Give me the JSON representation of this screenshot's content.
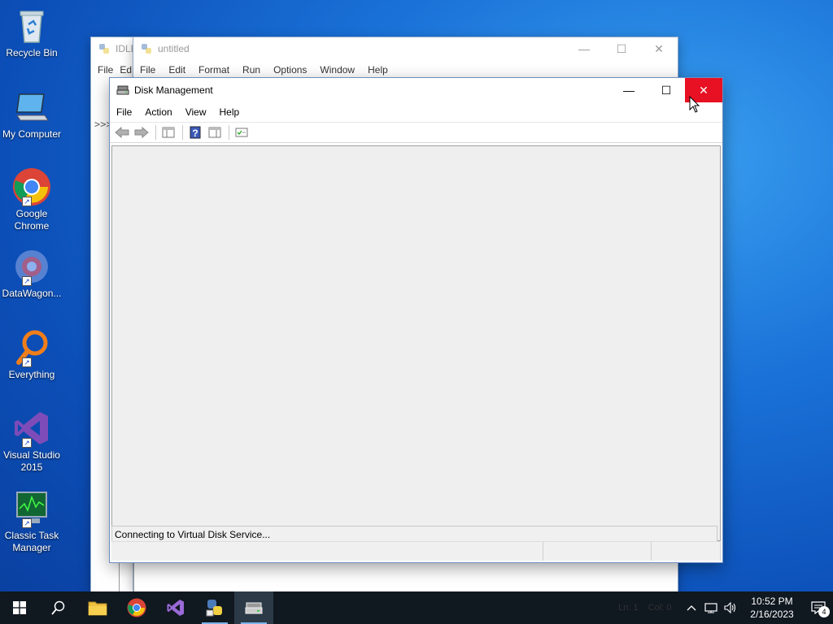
{
  "desktop": {
    "icons": [
      {
        "label": "Recycle Bin",
        "icon": "recycle-bin-icon"
      },
      {
        "label": "My Computer",
        "icon": "computer-icon"
      },
      {
        "label": "Google Chrome",
        "icon": "chrome-icon"
      },
      {
        "label": "DataWagon...",
        "icon": "datawagon-icon"
      },
      {
        "label": "Everything",
        "icon": "everything-search-icon"
      },
      {
        "label": "Visual Studio 2015",
        "icon": "visual-studio-icon"
      },
      {
        "label": "Classic Task Manager",
        "icon": "task-manager-icon"
      }
    ]
  },
  "idle_shell": {
    "title": "IDLE",
    "menu": [
      "File",
      "Ed"
    ],
    "prompt": ">>>"
  },
  "idle_editor": {
    "title": "untitled",
    "menu": [
      "File",
      "Edit",
      "Format",
      "Run",
      "Options",
      "Window",
      "Help"
    ],
    "status": {
      "ln": "Ln: 1",
      "col": "Col: 0"
    }
  },
  "disk_management": {
    "title": "Disk Management",
    "menu": [
      "File",
      "Action",
      "View",
      "Help"
    ],
    "toolbar": [
      "back-arrow-icon",
      "forward-arrow-icon",
      "show-hide-console-tree-icon",
      "help-icon",
      "show-hide-action-pane-icon",
      "properties-icon"
    ],
    "status_text": "Connecting to Virtual Disk Service...",
    "colors": {
      "close_hover": "#e81123",
      "content_bg": "#efefef"
    }
  },
  "taskbar": {
    "apps": [
      "start-icon",
      "search-icon",
      "file-explorer-icon",
      "chrome-icon",
      "visual-studio-icon",
      "python-idle-icon",
      "disk-management-icon"
    ],
    "active_app": "disk-management-icon",
    "time": "10:52 PM",
    "date": "2/16/2023",
    "notification_count": "4"
  }
}
